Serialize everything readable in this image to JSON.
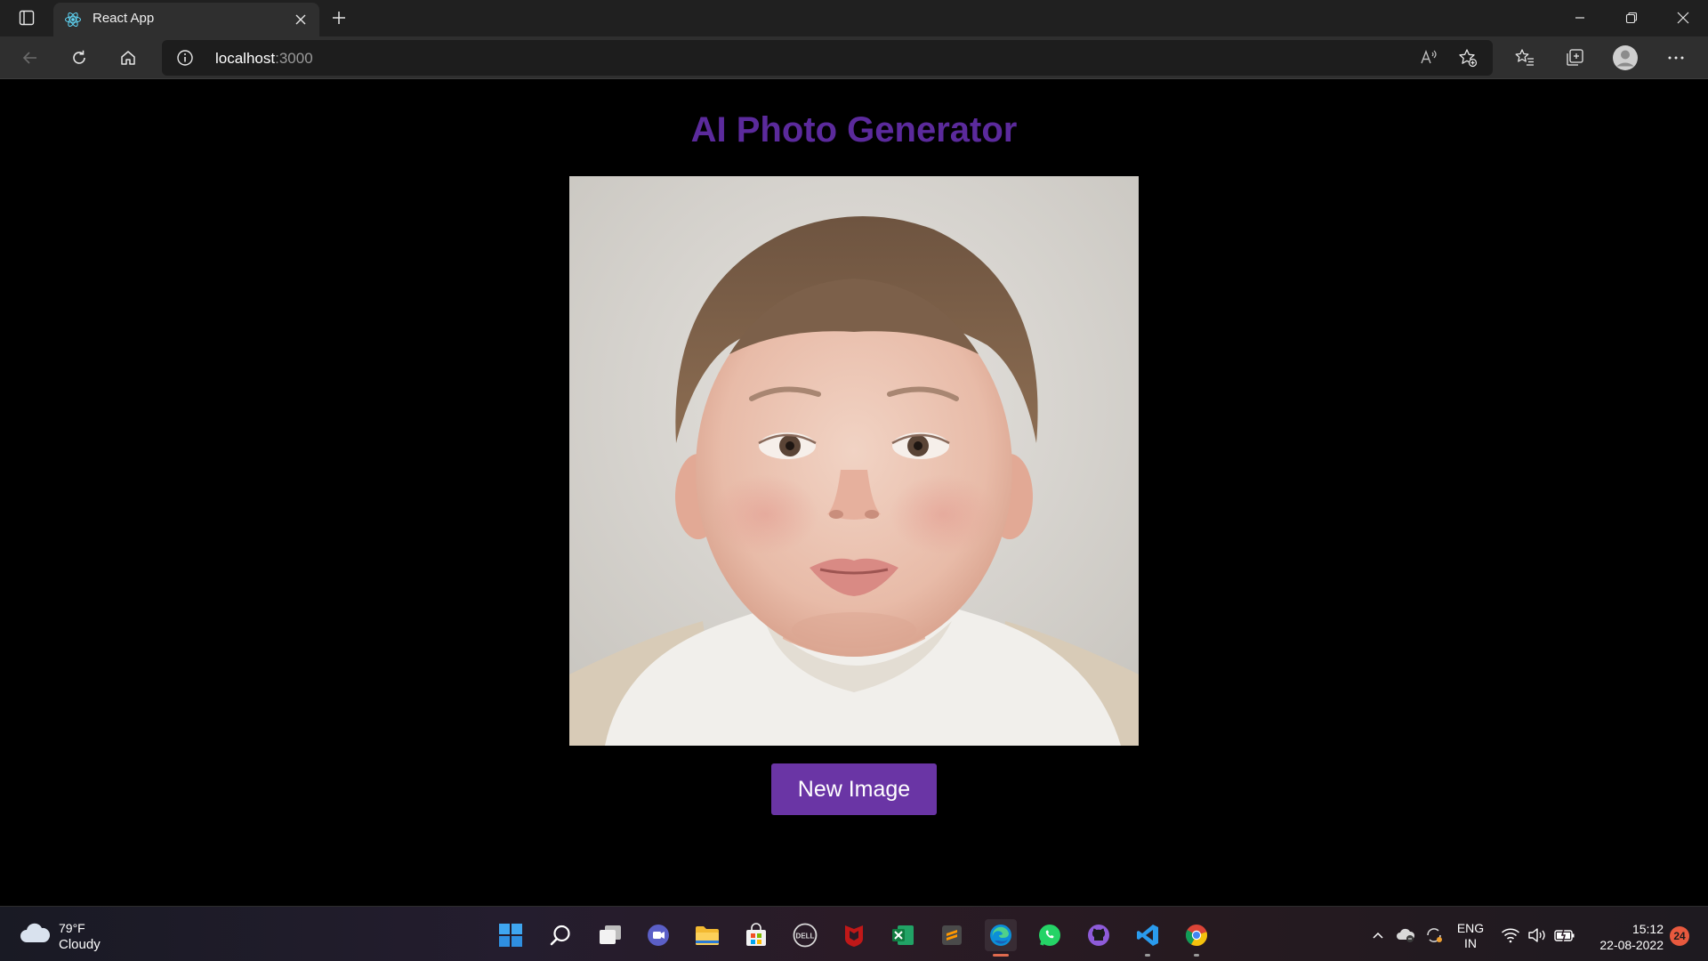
{
  "browser": {
    "tab_title": "React App",
    "url_host": "localhost",
    "url_port": ":3000"
  },
  "page": {
    "title": "AI Photo Generator",
    "new_image_label": "New Image",
    "title_color": "#5b2a9c",
    "button_color": "#6a35a5"
  },
  "taskbar": {
    "weather_temp": "79°F",
    "weather_desc": "Cloudy",
    "lang_line1": "ENG",
    "lang_line2": "IN",
    "time": "15:12",
    "date": "22-08-2022",
    "notification_count": "24",
    "apps": [
      "start-icon",
      "search-icon",
      "task-view-icon",
      "teams-chat-icon",
      "file-explorer-icon",
      "microsoft-store-icon",
      "dell-icon",
      "mcafee-icon",
      "excel-icon",
      "sublime-text-icon",
      "edge-icon",
      "whatsapp-icon",
      "github-desktop-icon",
      "vscode-icon",
      "chrome-icon"
    ]
  }
}
